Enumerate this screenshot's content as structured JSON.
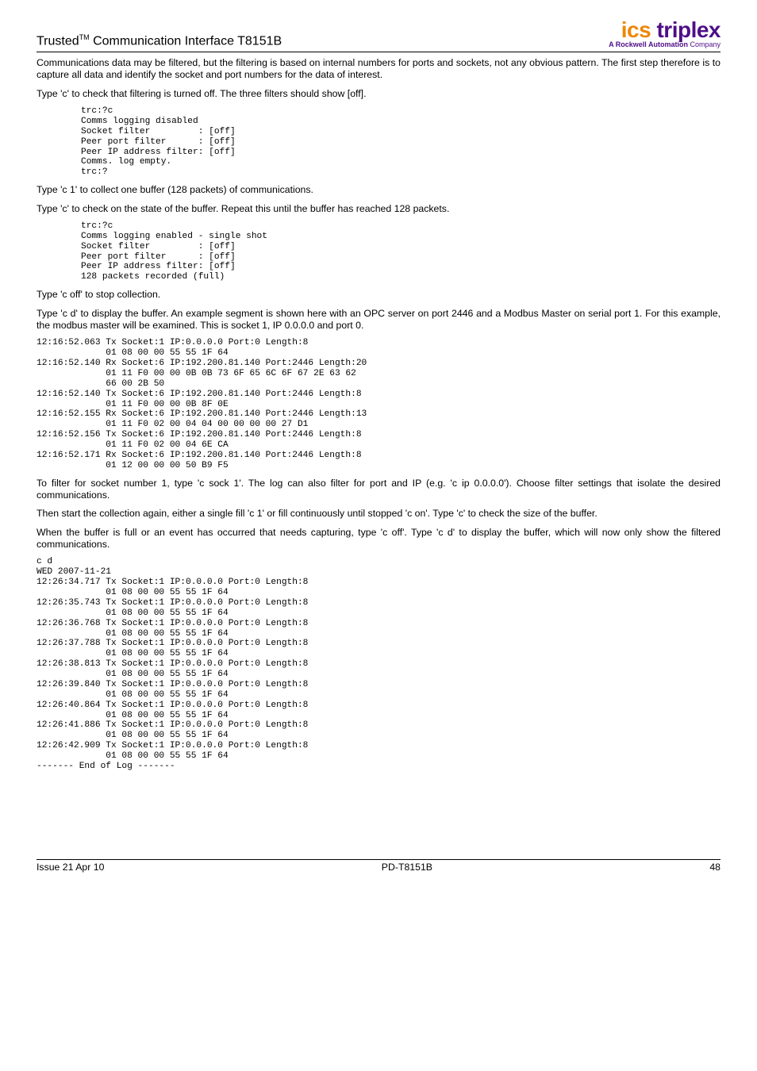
{
  "header": {
    "title_prefix": "Trusted",
    "title_tm": "TM",
    "title_rest": " Communication Interface T8151B",
    "logo_ics": "ics",
    "logo_triplex": " triplex",
    "logo_sub_bold": "A Rockwell Automation ",
    "logo_sub_light": "Company"
  },
  "p1": "Communications data may be filtered, but the filtering is based on internal numbers for ports and sockets, not any obvious pattern. The first step therefore is to capture all data and identify the socket and port numbers for the data of interest.",
  "p2": "Type 'c' to check that filtering is turned off. The three filters should show [off].",
  "block1": "trc:?c\nComms logging disabled\nSocket filter         : [off]\nPeer port filter      : [off]\nPeer IP address filter: [off]\nComms. log empty.\ntrc:?",
  "p3": "Type 'c 1' to collect one buffer (128 packets) of communications.",
  "p4": "Type 'c' to check on the state of the buffer. Repeat this until the buffer has reached 128 packets.",
  "block2": "trc:?c\nComms logging enabled - single shot\nSocket filter         : [off]\nPeer port filter      : [off]\nPeer IP address filter: [off]\n128 packets recorded (full)",
  "p5": "Type 'c off' to stop collection.",
  "p6": "Type 'c d' to display the buffer. An example segment is shown here with an OPC server on port 2446 and a Modbus Master on serial port 1. For this example, the modbus master will be examined. This is socket 1, IP 0.0.0.0 and port 0.",
  "block3": "12:16:52.063 Tx Socket:1 IP:0.0.0.0 Port:0 Length:8\n             01 08 00 00 55 55 1F 64\n12:16:52.140 Rx Socket:6 IP:192.200.81.140 Port:2446 Length:20\n             01 11 F0 00 00 0B 0B 73 6F 65 6C 6F 67 2E 63 62\n             66 00 2B 50\n12:16:52.140 Tx Socket:6 IP:192.200.81.140 Port:2446 Length:8\n             01 11 F0 00 00 0B 8F 0E\n12:16:52.155 Rx Socket:6 IP:192.200.81.140 Port:2446 Length:13\n             01 11 F0 02 00 04 04 00 00 00 00 27 D1\n12:16:52.156 Tx Socket:6 IP:192.200.81.140 Port:2446 Length:8\n             01 11 F0 02 00 04 6E CA\n12:16:52.171 Rx Socket:6 IP:192.200.81.140 Port:2446 Length:8\n             01 12 00 00 00 50 B9 F5",
  "p7": "To filter for socket number 1, type 'c sock 1'. The log can also filter for port and IP (e.g. 'c ip 0.0.0.0'). Choose filter settings that isolate the desired communications.",
  "p8": "Then start the collection again, either a single fill 'c 1' or fill continuously until stopped 'c on'. Type 'c' to check the size of the buffer.",
  "p9": "When the buffer is full or an event has occurred that needs capturing, type 'c off'. Type 'c d' to display the buffer, which will now only show the filtered communications.",
  "block4": "c d\nWED 2007-11-21\n12:26:34.717 Tx Socket:1 IP:0.0.0.0 Port:0 Length:8\n             01 08 00 00 55 55 1F 64\n12:26:35.743 Tx Socket:1 IP:0.0.0.0 Port:0 Length:8\n             01 08 00 00 55 55 1F 64\n12:26:36.768 Tx Socket:1 IP:0.0.0.0 Port:0 Length:8\n             01 08 00 00 55 55 1F 64\n12:26:37.788 Tx Socket:1 IP:0.0.0.0 Port:0 Length:8\n             01 08 00 00 55 55 1F 64\n12:26:38.813 Tx Socket:1 IP:0.0.0.0 Port:0 Length:8\n             01 08 00 00 55 55 1F 64\n12:26:39.840 Tx Socket:1 IP:0.0.0.0 Port:0 Length:8\n             01 08 00 00 55 55 1F 64\n12:26:40.864 Tx Socket:1 IP:0.0.0.0 Port:0 Length:8\n             01 08 00 00 55 55 1F 64\n12:26:41.886 Tx Socket:1 IP:0.0.0.0 Port:0 Length:8\n             01 08 00 00 55 55 1F 64\n12:26:42.909 Tx Socket:1 IP:0.0.0.0 Port:0 Length:8\n             01 08 00 00 55 55 1F 64\n------- End of Log -------",
  "footer": {
    "left": "Issue 21 Apr 10",
    "center": "PD-T8151B",
    "right": "48"
  }
}
